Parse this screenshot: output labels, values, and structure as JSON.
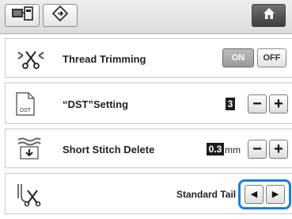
{
  "toolbar": {
    "left_buttons": [
      {
        "icon": "embroidery-frame-icon"
      },
      {
        "icon": "diamond-arrow-icon"
      }
    ],
    "home_icon": "home-icon"
  },
  "settings": {
    "thread_trimming": {
      "icon": "scissors-trim-icon",
      "label": "Thread Trimming",
      "on_label": "ON",
      "off_label": "OFF",
      "selected": "ON"
    },
    "dst_setting": {
      "icon": "dst-file-icon",
      "icon_text": "DST",
      "label": "“DST”Setting",
      "value": "3",
      "minus": "−",
      "plus": "+"
    },
    "short_stitch_delete": {
      "icon": "short-stitch-icon",
      "label": "Short Stitch Delete",
      "value": "0.3",
      "unit": "mm",
      "minus": "−",
      "plus": "+"
    },
    "tail": {
      "icon": "needle-scissors-icon",
      "value": "Standard Tail",
      "left_arrow": "◀",
      "right_arrow": "▶"
    }
  },
  "colors": {
    "highlight": "#1a7fd6",
    "value_box": "#1e1e1e"
  }
}
